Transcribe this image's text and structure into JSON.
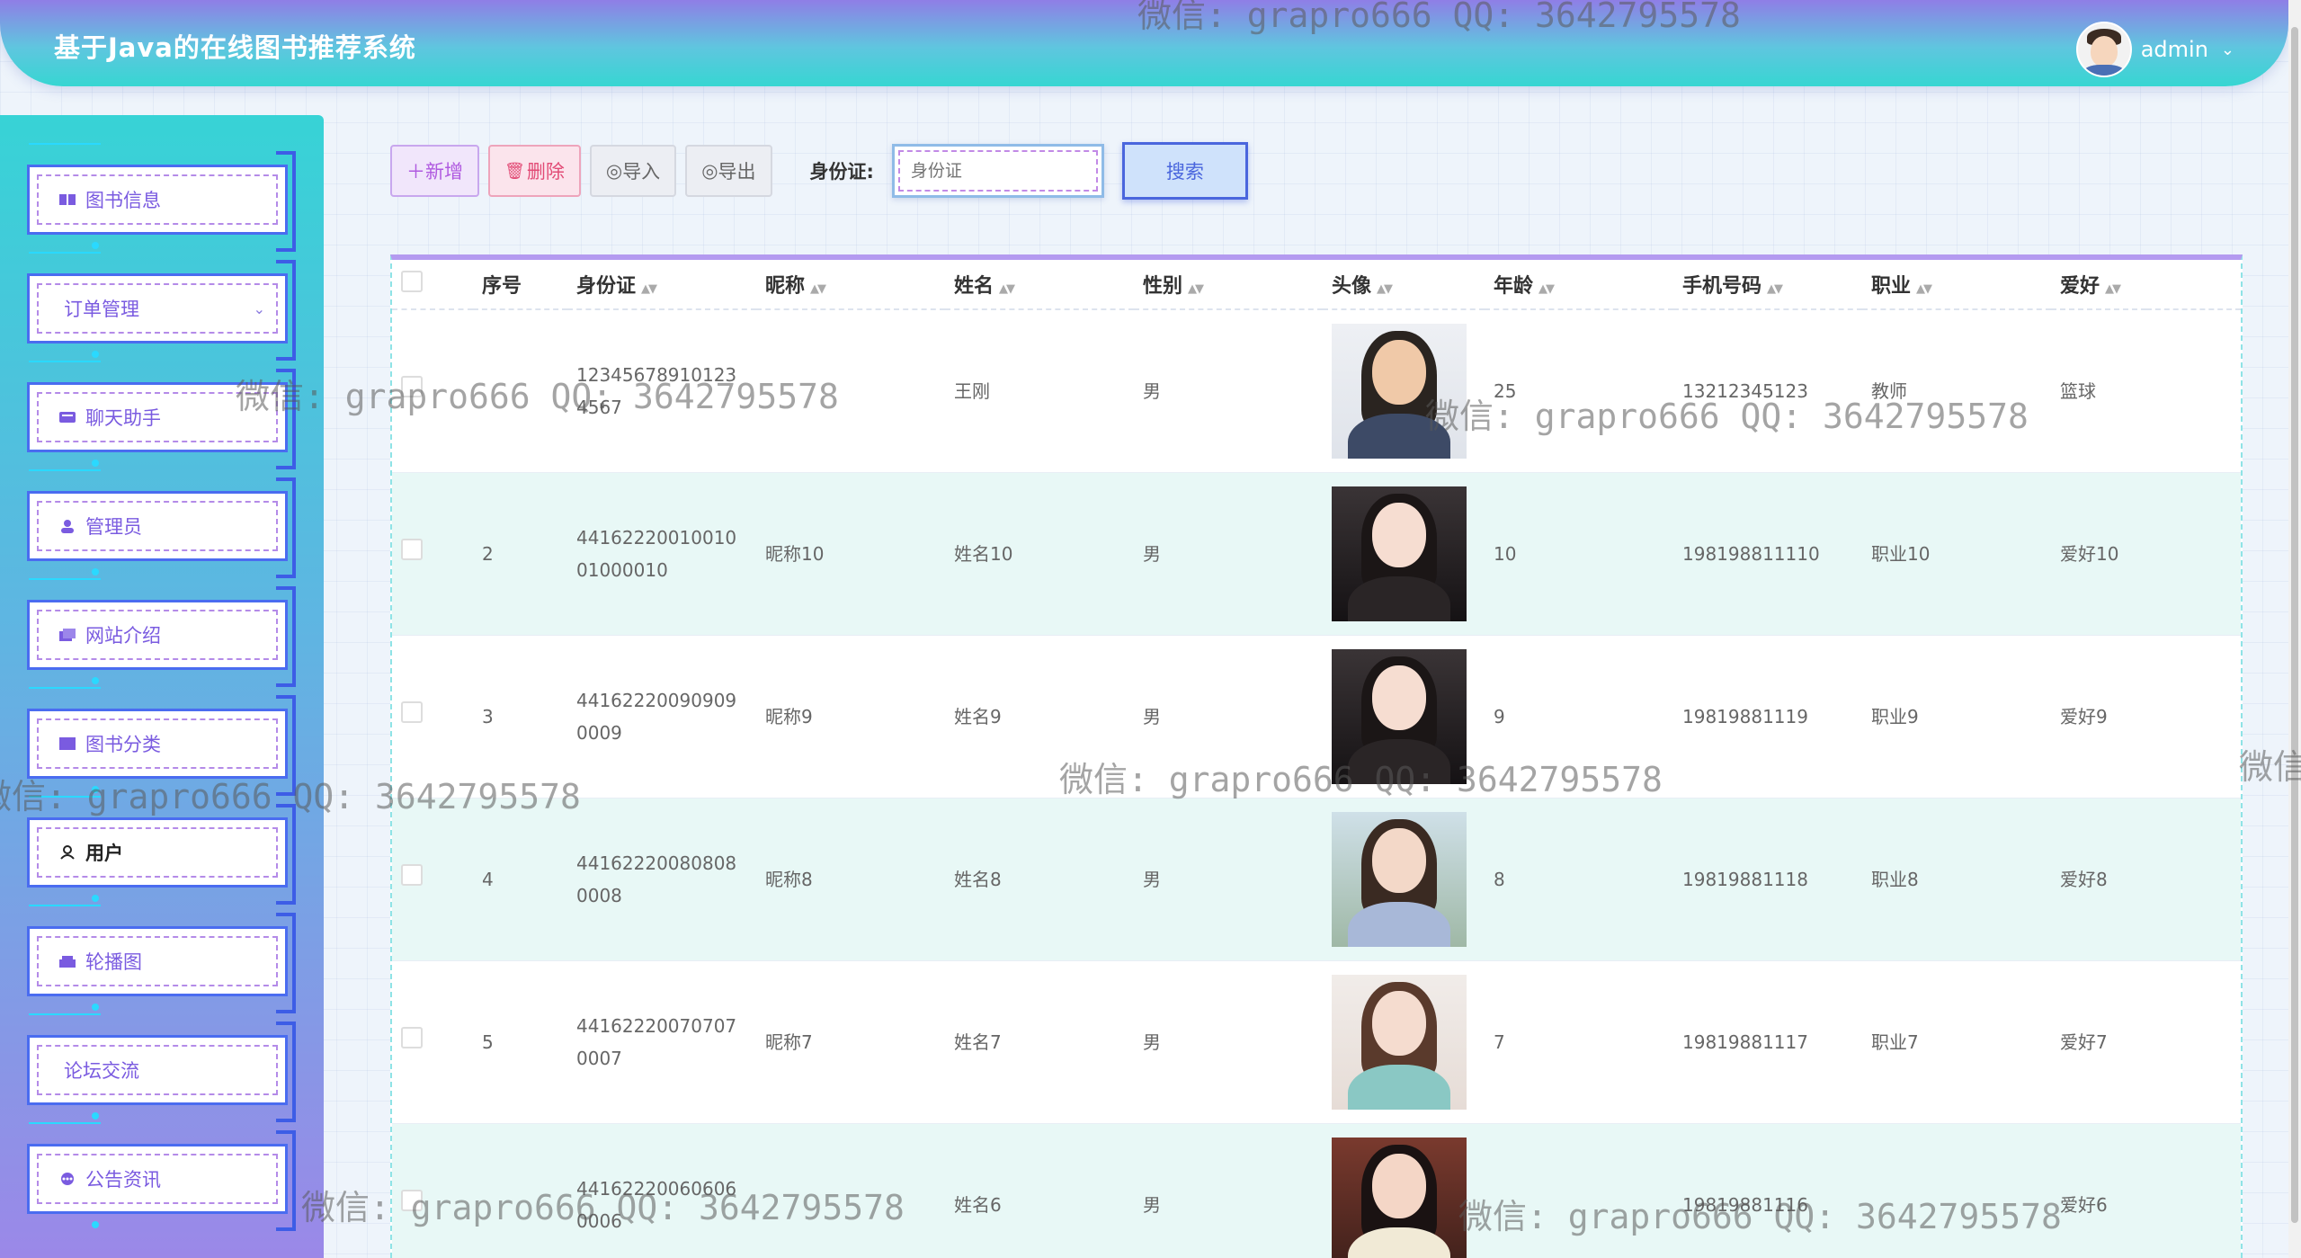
{
  "header": {
    "title": "基于Java的在线图书推荐系统",
    "username": "admin"
  },
  "sidebar": {
    "items": [
      {
        "label": "图书信息",
        "icon": "book-icon",
        "active": false,
        "has_caret": false
      },
      {
        "label": "订单管理",
        "icon": "",
        "active": false,
        "has_caret": true
      },
      {
        "label": "聊天助手",
        "icon": "chat-icon",
        "active": false,
        "has_caret": false
      },
      {
        "label": "管理员",
        "icon": "admin-icon",
        "active": false,
        "has_caret": false
      },
      {
        "label": "网站介绍",
        "icon": "info-icon",
        "active": false,
        "has_caret": false
      },
      {
        "label": "图书分类",
        "icon": "category-icon",
        "active": false,
        "has_caret": false
      },
      {
        "label": "用户",
        "icon": "user-icon",
        "active": true,
        "has_caret": false
      },
      {
        "label": "轮播图",
        "icon": "carousel-icon",
        "active": false,
        "has_caret": false
      },
      {
        "label": "论坛交流",
        "icon": "",
        "active": false,
        "has_caret": false
      },
      {
        "label": "公告资讯",
        "icon": "notice-icon",
        "active": false,
        "has_caret": false
      }
    ]
  },
  "toolbar": {
    "add_label": "新增",
    "delete_label": "删除",
    "import_label": "导入",
    "export_label": "导出",
    "search_label": "身份证:",
    "search_placeholder": "身份证",
    "search_button": "搜索"
  },
  "table": {
    "columns": [
      "序号",
      "身份证",
      "昵称",
      "姓名",
      "性别",
      "头像",
      "年龄",
      "手机号码",
      "职业",
      "爱好"
    ],
    "rows": [
      {
        "index": "",
        "id_card": "123456789101234567",
        "nickname": "",
        "name": "王刚",
        "gender": "男",
        "age": "25",
        "phone": "13212345123",
        "job": "教师",
        "hobby": "篮球",
        "avatar": "man-glasses-suit"
      },
      {
        "index": "2",
        "id_card": "4416222001001001000010",
        "nickname": "昵称10",
        "name": "姓名10",
        "gender": "男",
        "age": "10",
        "phone": "198198811110",
        "job": "职业10",
        "hobby": "爱好10",
        "avatar": "woman-dark-hair"
      },
      {
        "index": "3",
        "id_card": "441622200909090009",
        "nickname": "昵称9",
        "name": "姓名9",
        "gender": "男",
        "age": "9",
        "phone": "19819881119",
        "job": "职业9",
        "hobby": "爱好9",
        "avatar": "woman-dark-hair"
      },
      {
        "index": "4",
        "id_card": "441622200808080008",
        "nickname": "昵称8",
        "name": "姓名8",
        "gender": "男",
        "age": "8",
        "phone": "19819881118",
        "job": "职业8",
        "hobby": "爱好8",
        "avatar": "woman-outdoor"
      },
      {
        "index": "5",
        "id_card": "441622200707070007",
        "nickname": "昵称7",
        "name": "姓名7",
        "gender": "男",
        "age": "7",
        "phone": "19819881117",
        "job": "职业7",
        "hobby": "爱好7",
        "avatar": "woman-light"
      },
      {
        "index": "",
        "id_card": "441622200606060006",
        "nickname": "",
        "name": "姓名6",
        "gender": "男",
        "age": "",
        "phone": "19819881116",
        "job": "",
        "hobby": "爱好6",
        "avatar": "woman-white-coat"
      }
    ]
  },
  "watermark": "微信: grapro666 QQ: 3642795578",
  "watermark_partial": "微信",
  "colors": {
    "accent": "#7a5be0",
    "header_top": "#8f7ee6",
    "header_bottom": "#36d6d2",
    "alt_row": "#e8f8f6"
  }
}
